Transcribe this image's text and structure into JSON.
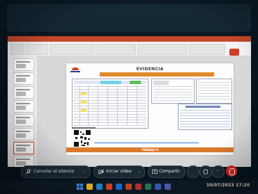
{
  "meeting": {
    "corner_text": "",
    "center_text": ""
  },
  "slide": {
    "title": "EVIDENCIA",
    "banner_text": "",
    "footer_text": "TRABAJO 8"
  },
  "controls": {
    "mute_label": "Cancelar el silencio",
    "video_label": "Iniciar video",
    "share_label": "Compartir"
  },
  "taskbar": {
    "datetime": "10/07/2023 17:20"
  },
  "colors": {
    "ppt_accent": "#c5482b",
    "banner": "#e08a2e",
    "end_call": "#d3271f"
  },
  "icons": [
    "microphone-icon",
    "video-camera-icon",
    "share-screen-icon",
    "chevron-down-icon",
    "hand-icon",
    "more-icon",
    "end-call-icon",
    "windows-start-icon"
  ]
}
